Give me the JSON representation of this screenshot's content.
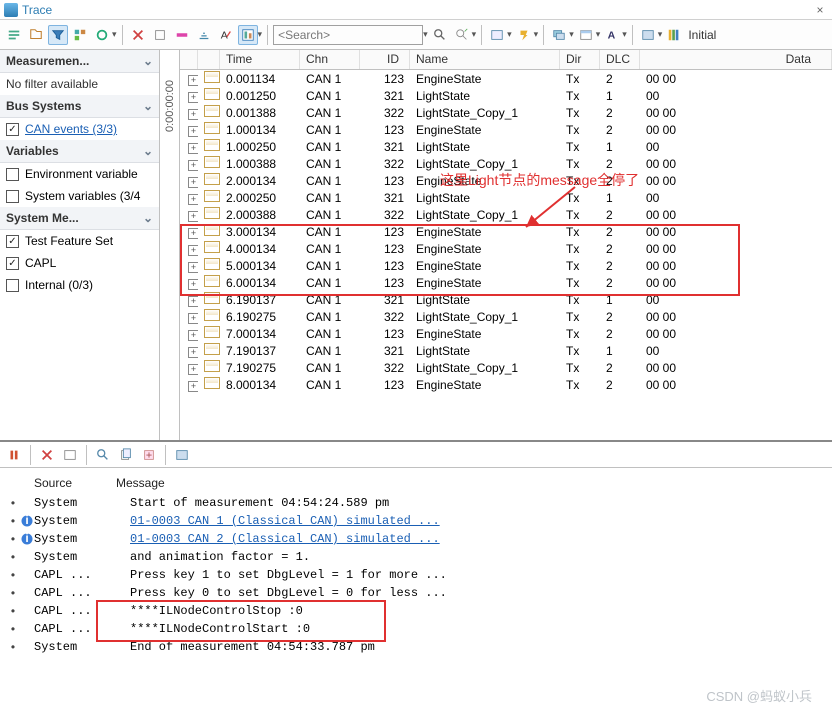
{
  "window": {
    "title": "Trace",
    "close": "×"
  },
  "toolbar": {
    "search_placeholder": "<Search>",
    "initial": "Initial"
  },
  "sidebar": {
    "nofilter": "No filter available",
    "sect_measure": "Measuremen...",
    "sect_bus": "Bus Systems",
    "can_events": "CAN events (3/3)",
    "sect_vars": "Variables",
    "env_var": "Environment variable",
    "sys_var": "System variables (3/4",
    "sect_sysmsg": "System Me...",
    "tfs": "Test Feature Set",
    "capl": "CAPL",
    "internal": "Internal (0/3)"
  },
  "vlabel": "0:00:00:00",
  "grid": {
    "headers": {
      "time": "Time",
      "chn": "Chn",
      "id": "ID",
      "name": "Name",
      "dir": "Dir",
      "dlc": "DLC",
      "data": "Data"
    },
    "rows": [
      {
        "time": "0.001134",
        "chn": "CAN 1",
        "id": "123",
        "name": "EngineState",
        "dir": "Tx",
        "dlc": "2",
        "data": "00 00"
      },
      {
        "time": "0.001250",
        "chn": "CAN 1",
        "id": "321",
        "name": "LightState",
        "dir": "Tx",
        "dlc": "1",
        "data": "00"
      },
      {
        "time": "0.001388",
        "chn": "CAN 1",
        "id": "322",
        "name": "LightState_Copy_1",
        "dir": "Tx",
        "dlc": "2",
        "data": "00 00"
      },
      {
        "time": "1.000134",
        "chn": "CAN 1",
        "id": "123",
        "name": "EngineState",
        "dir": "Tx",
        "dlc": "2",
        "data": "00 00"
      },
      {
        "time": "1.000250",
        "chn": "CAN 1",
        "id": "321",
        "name": "LightState",
        "dir": "Tx",
        "dlc": "1",
        "data": "00"
      },
      {
        "time": "1.000388",
        "chn": "CAN 1",
        "id": "322",
        "name": "LightState_Copy_1",
        "dir": "Tx",
        "dlc": "2",
        "data": "00 00"
      },
      {
        "time": "2.000134",
        "chn": "CAN 1",
        "id": "123",
        "name": "EngineState",
        "dir": "Tx",
        "dlc": "2",
        "data": "00 00"
      },
      {
        "time": "2.000250",
        "chn": "CAN 1",
        "id": "321",
        "name": "LightState",
        "dir": "Tx",
        "dlc": "1",
        "data": "00"
      },
      {
        "time": "2.000388",
        "chn": "CAN 1",
        "id": "322",
        "name": "LightState_Copy_1",
        "dir": "Tx",
        "dlc": "2",
        "data": "00 00"
      },
      {
        "time": "3.000134",
        "chn": "CAN 1",
        "id": "123",
        "name": "EngineState",
        "dir": "Tx",
        "dlc": "2",
        "data": "00 00"
      },
      {
        "time": "4.000134",
        "chn": "CAN 1",
        "id": "123",
        "name": "EngineState",
        "dir": "Tx",
        "dlc": "2",
        "data": "00 00"
      },
      {
        "time": "5.000134",
        "chn": "CAN 1",
        "id": "123",
        "name": "EngineState",
        "dir": "Tx",
        "dlc": "2",
        "data": "00 00"
      },
      {
        "time": "6.000134",
        "chn": "CAN 1",
        "id": "123",
        "name": "EngineState",
        "dir": "Tx",
        "dlc": "2",
        "data": "00 00"
      },
      {
        "time": "6.190137",
        "chn": "CAN 1",
        "id": "321",
        "name": "LightState",
        "dir": "Tx",
        "dlc": "1",
        "data": "00"
      },
      {
        "time": "6.190275",
        "chn": "CAN 1",
        "id": "322",
        "name": "LightState_Copy_1",
        "dir": "Tx",
        "dlc": "2",
        "data": "00 00"
      },
      {
        "time": "7.000134",
        "chn": "CAN 1",
        "id": "123",
        "name": "EngineState",
        "dir": "Tx",
        "dlc": "2",
        "data": "00 00"
      },
      {
        "time": "7.190137",
        "chn": "CAN 1",
        "id": "321",
        "name": "LightState",
        "dir": "Tx",
        "dlc": "1",
        "data": "00"
      },
      {
        "time": "7.190275",
        "chn": "CAN 1",
        "id": "322",
        "name": "LightState_Copy_1",
        "dir": "Tx",
        "dlc": "2",
        "data": "00 00"
      },
      {
        "time": "8.000134",
        "chn": "CAN 1",
        "id": "123",
        "name": "EngineState",
        "dir": "Tx",
        "dlc": "2",
        "data": "00 00"
      }
    ]
  },
  "annotation": "这里Light节点的message全停了",
  "log": {
    "headers": {
      "source": "Source",
      "message": "Message"
    },
    "rows": [
      {
        "ico": "",
        "src": "System",
        "msg": "Start of measurement 04:54:24.589 pm",
        "link": false
      },
      {
        "ico": "i",
        "src": "System",
        "msg": "01-0003 CAN 1 (Classical CAN)  simulated ...",
        "link": true
      },
      {
        "ico": "i",
        "src": "System",
        "msg": "01-0003 CAN 2 (Classical CAN)  simulated ...",
        "link": true
      },
      {
        "ico": "",
        "src": "System",
        "msg": "   and animation factor = 1.",
        "link": false
      },
      {
        "ico": "",
        "src": "CAPL ...",
        "msg": "Press key 1 to set DbgLevel = 1 for more ...",
        "link": false
      },
      {
        "ico": "",
        "src": "CAPL ...",
        "msg": "Press key 0 to set DbgLevel = 0 for less ...",
        "link": false
      },
      {
        "ico": "",
        "src": "CAPL ...",
        "msg": "****ILNodeControlStop :0",
        "link": false
      },
      {
        "ico": "",
        "src": "CAPL ...",
        "msg": "****ILNodeControlStart :0",
        "link": false
      },
      {
        "ico": "",
        "src": "System",
        "msg": "End of measurement 04:54:33.787 pm",
        "link": false
      }
    ]
  },
  "watermark": "CSDN @蚂蚁小兵"
}
